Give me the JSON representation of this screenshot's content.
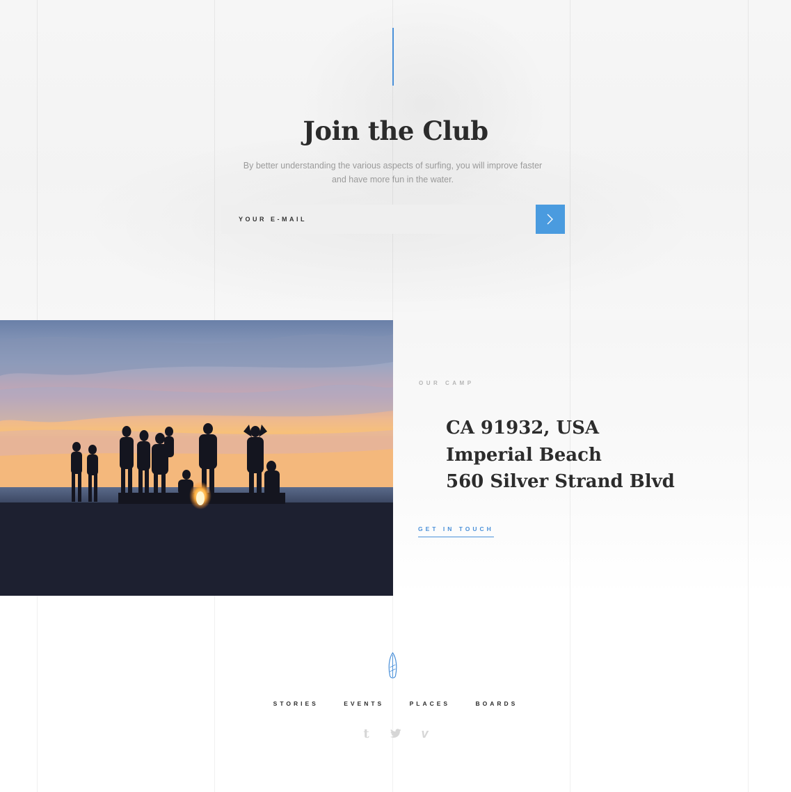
{
  "newsletter": {
    "title": "Join the Club",
    "subtitle_line1": "By better understanding the various aspects of surfing, you will improve faster",
    "subtitle_line2": "and have more fun in the water.",
    "email_placeholder": "YOUR E-MAIL",
    "submit_icon": "chevron-right-icon",
    "accent_color": "#4a90d9"
  },
  "camp": {
    "label": "OUR CAMP",
    "address_lines": [
      "CA 91932, USA",
      "Imperial Beach",
      "560 Silver Strand Blvd"
    ],
    "cta": "GET IN TOUCH"
  },
  "footer": {
    "logo_icon": "surfboard-icon",
    "nav": [
      "STORIES",
      "EVENTS",
      "PLACES",
      "BOARDS"
    ],
    "social": [
      {
        "icon": "tumblr-icon",
        "glyph": "t"
      },
      {
        "icon": "twitter-icon",
        "glyph": ""
      },
      {
        "icon": "vimeo-icon",
        "glyph": "v"
      }
    ]
  }
}
